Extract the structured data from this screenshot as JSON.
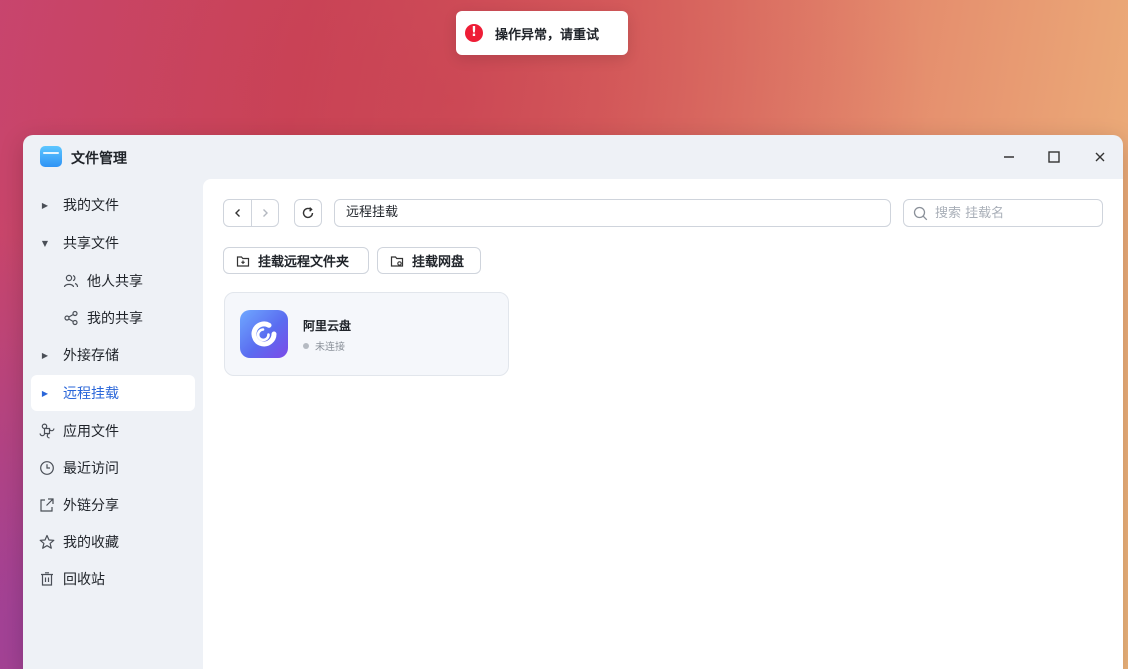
{
  "toast": {
    "message": "操作异常，请重试",
    "icon": "error-icon",
    "color": "#ee1d36"
  },
  "window": {
    "title": "文件管理",
    "controls": [
      "minimize-icon",
      "maximize-icon",
      "close-icon"
    ]
  },
  "sidebar": {
    "items": [
      {
        "label": "我的文件",
        "icon": "caret-right-icon"
      },
      {
        "label": "共享文件",
        "icon": "caret-down-icon"
      },
      {
        "label": "他人共享",
        "icon": "users-icon"
      },
      {
        "label": "我的共享",
        "icon": "share-icon"
      },
      {
        "label": "外接存储",
        "icon": "caret-right-icon"
      },
      {
        "label": "远程挂载",
        "icon": "caret-right-icon",
        "active": true
      },
      {
        "label": "应用文件",
        "icon": "command-icon"
      },
      {
        "label": "最近访问",
        "icon": "clock-icon"
      },
      {
        "label": "外链分享",
        "icon": "external-share-icon"
      },
      {
        "label": "我的收藏",
        "icon": "star-icon"
      },
      {
        "label": "回收站",
        "icon": "trash-icon"
      }
    ],
    "accent": "#2a66d9"
  },
  "toolbar": {
    "path": "远程挂载",
    "search_placeholder": "搜索 挂载名"
  },
  "actions": {
    "mount_folder": "挂载远程文件夹",
    "mount_drive": "挂载网盘"
  },
  "mounts": [
    {
      "name": "阿里云盘",
      "status": "未连接",
      "icon": "aliyun-drive-icon"
    }
  ]
}
